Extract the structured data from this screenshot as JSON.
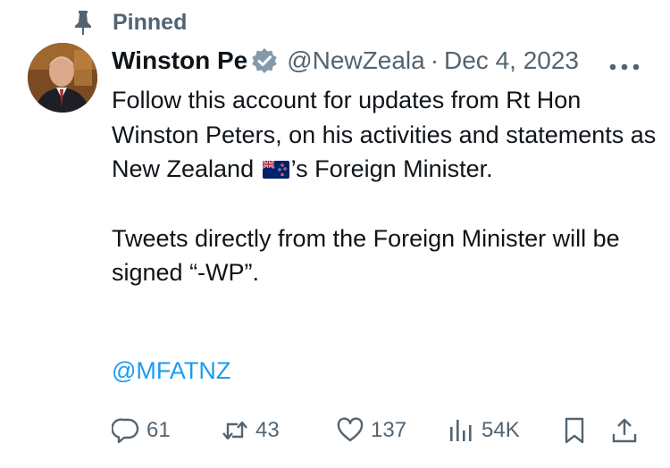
{
  "pinned": {
    "label": "Pinned",
    "icon": "pin-icon"
  },
  "author": {
    "display_name": "Winston Pe",
    "handle": "@NewZeala",
    "separator": "·",
    "date": "Dec 4, 2023",
    "verified_color": "#829aab"
  },
  "tweet": {
    "paragraph1_before_flag": "Follow this account for updates from Rt Hon Winston Peters, on his activities and statements as New Zealand ",
    "paragraph1_after_flag": "’s Foreign Minister.",
    "paragraph2": "Tweets directly from the Foreign Minister will be signed “-WP”.",
    "mention": "@MFATNZ",
    "flag_icon": "new-zealand-flag-emoji"
  },
  "actions": {
    "replies": "61",
    "retweets": "43",
    "likes": "137",
    "views": "54K"
  },
  "colors": {
    "text": "#0f1419",
    "secondary": "#536471",
    "link": "#1d9bf0"
  }
}
